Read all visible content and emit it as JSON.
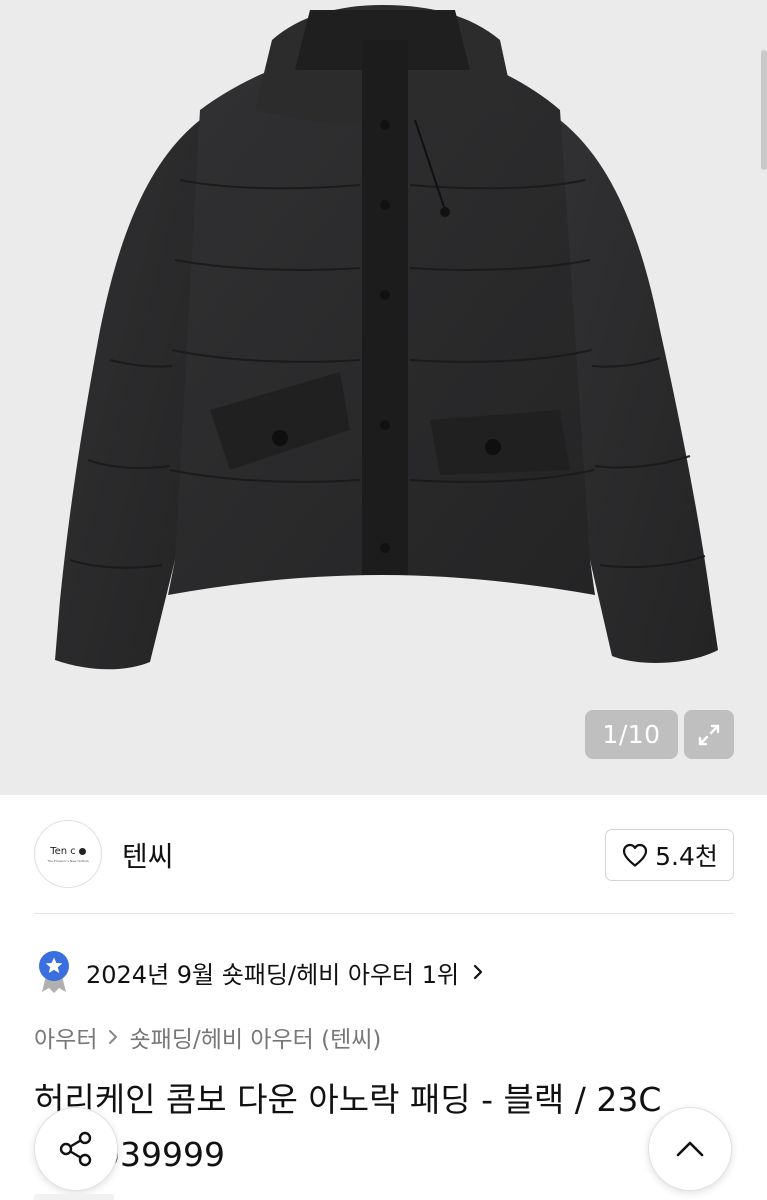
{
  "product_image": {
    "alt": "",
    "counter": {
      "current": "1",
      "separator": " / ",
      "total": "10"
    },
    "expand_icon": "expand-arrows-icon",
    "background": "#ebebeb",
    "jacket_color": "#2a2a2b"
  },
  "brand": {
    "logo_text": "Ten c",
    "logo_subtext": "The Emperor's New Clothes",
    "name": "텐씨",
    "like_icon": "heart-outline-icon",
    "like_count": "5.4천"
  },
  "ranking": {
    "badge_icon": "star-badge-icon",
    "badge_color": "#3b6fe0",
    "text": "2024년 9월 숏패딩/헤비 아우터 1위",
    "chevron_icon": "chevron-right-icon"
  },
  "breadcrumb": {
    "items": [
      "아우터",
      "숏패딩/헤비 아우터 (텐씨)"
    ],
    "separator_icon": "chevron-right-icon"
  },
  "product": {
    "title_line1": "허리케인 콤보 다운 아노락 패딩 - 블랙 / 23C",
    "title_line2": "C03039999"
  },
  "floating": {
    "share_icon": "share-icon",
    "scroll_top_icon": "chevron-up-icon"
  }
}
